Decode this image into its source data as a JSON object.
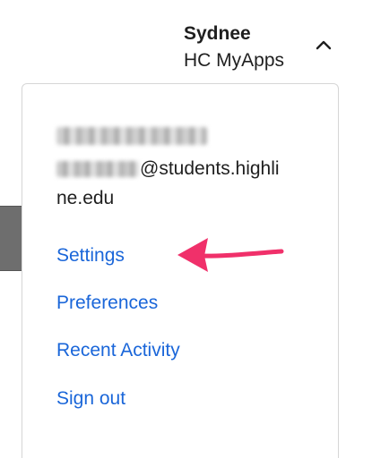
{
  "header": {
    "user_first_name": "Sydnee",
    "app_name": "HC MyApps",
    "chevron_icon": "chevron-up-icon"
  },
  "dropdown": {
    "email_suffix": "@students.highli",
    "email_suffix_line2": "ne.edu",
    "menu": [
      {
        "label": "Settings"
      },
      {
        "label": "Preferences"
      },
      {
        "label": "Recent Activity"
      },
      {
        "label": "Sign out"
      }
    ]
  },
  "annotation": {
    "arrow_color": "#f0306a"
  },
  "colors": {
    "link": "#1a66d9",
    "text": "#1f1f1f"
  }
}
